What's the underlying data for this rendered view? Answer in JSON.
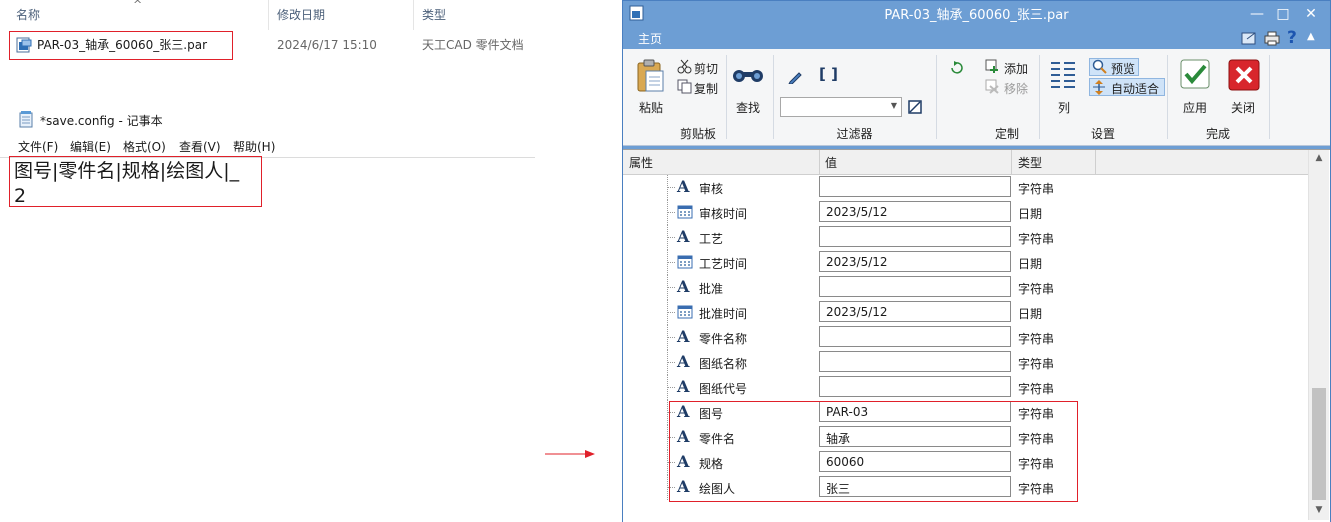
{
  "explorer": {
    "columns": [
      "名称",
      "修改日期",
      "类型"
    ],
    "file": {
      "name": "PAR-03_轴承_60060_张三.par",
      "modified": "2024/6/17 15:10",
      "type": "天工CAD 零件文档"
    }
  },
  "notepad": {
    "title": "*save.config - 记事本",
    "menu": [
      "文件(F)",
      "编辑(E)",
      "格式(O)",
      "查看(V)",
      "帮助(H)"
    ],
    "lines": [
      "图号|零件名|规格|绘图人|_",
      "2"
    ]
  },
  "dialog": {
    "title": "PAR-03_轴承_60060_张三.par",
    "tab": "主页",
    "ribbon": {
      "paste": "粘贴",
      "cut": "剪切",
      "copy": "复制",
      "clipboard": "剪贴板",
      "find": "查找",
      "filter": "过滤器",
      "add": "添加",
      "remove": "移除",
      "define": "定制",
      "columns": "列",
      "preview": "预览",
      "autofit": "自动适合",
      "settings": "设置",
      "apply": "应用",
      "close": "关闭",
      "done": "完成"
    },
    "grid": {
      "headers": [
        "属性",
        "值",
        "类型"
      ],
      "rows": [
        {
          "icon": "text",
          "name": "审核",
          "value": "",
          "type": "字符串"
        },
        {
          "icon": "date",
          "name": "审核时间",
          "value": "2023/5/12",
          "type": "日期"
        },
        {
          "icon": "text",
          "name": "工艺",
          "value": "",
          "type": "字符串"
        },
        {
          "icon": "date",
          "name": "工艺时间",
          "value": "2023/5/12",
          "type": "日期"
        },
        {
          "icon": "text",
          "name": "批准",
          "value": "",
          "type": "字符串"
        },
        {
          "icon": "date",
          "name": "批准时间",
          "value": "2023/5/12",
          "type": "日期"
        },
        {
          "icon": "text",
          "name": "零件名称",
          "value": "",
          "type": "字符串"
        },
        {
          "icon": "text",
          "name": "图纸名称",
          "value": "",
          "type": "字符串"
        },
        {
          "icon": "text",
          "name": "图纸代号",
          "value": "",
          "type": "字符串"
        },
        {
          "icon": "text",
          "name": "图号",
          "value": "PAR-03",
          "type": "字符串"
        },
        {
          "icon": "text",
          "name": "零件名",
          "value": "轴承",
          "type": "字符串"
        },
        {
          "icon": "text",
          "name": "规格",
          "value": "60060",
          "type": "字符串"
        },
        {
          "icon": "text",
          "name": "绘图人",
          "value": "张三",
          "type": "字符串"
        }
      ]
    }
  },
  "colors": {
    "title_blue": "#6d9ed4",
    "highlight_red": "#e0202a"
  }
}
